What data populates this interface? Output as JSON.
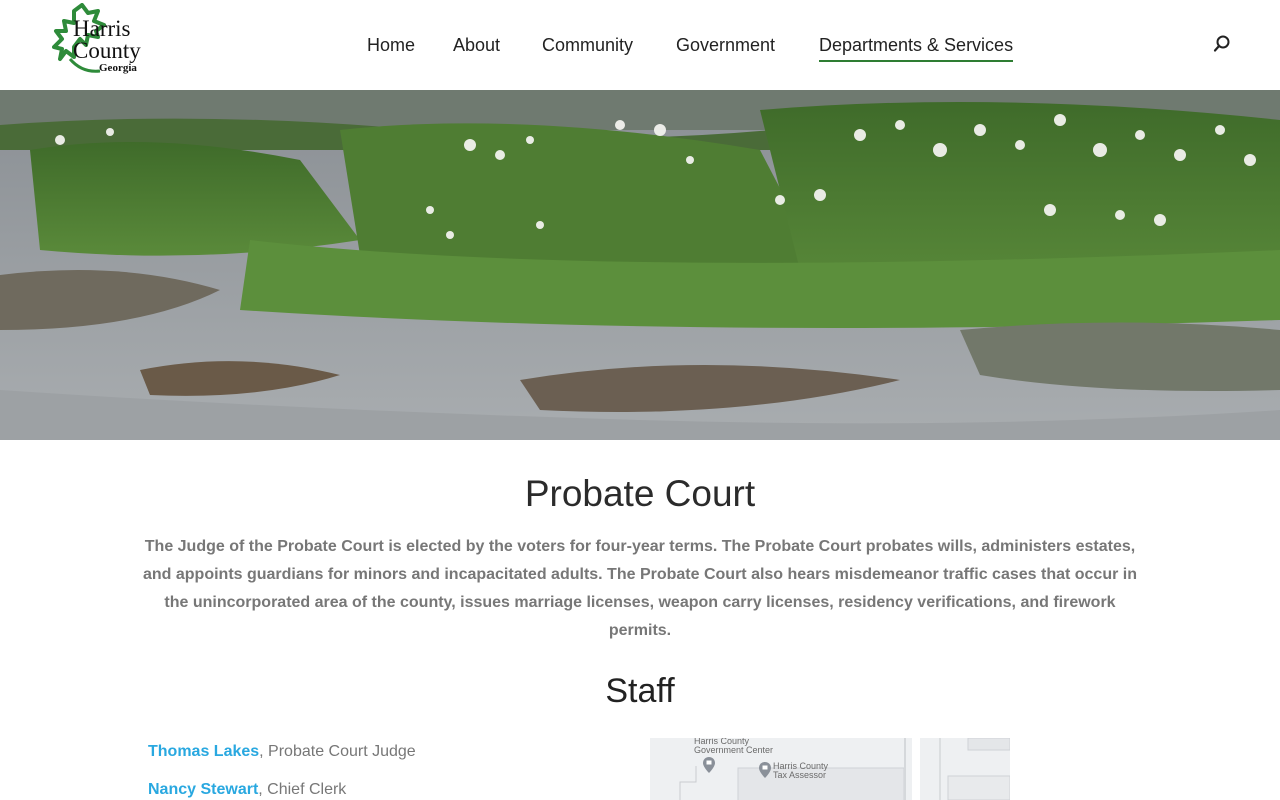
{
  "site": {
    "logo": {
      "line1": "Harris",
      "line2": "County",
      "line3": "Georgia"
    }
  },
  "nav": {
    "items": [
      {
        "label": "Home"
      },
      {
        "label": "About"
      },
      {
        "label": "Community"
      },
      {
        "label": "Government"
      },
      {
        "label": "Departments & Services",
        "active": true
      }
    ],
    "search_icon": "search-icon"
  },
  "hero": {
    "image": "river-shoals-lilies-photo"
  },
  "main": {
    "title": "Probate Court",
    "intro": "The Judge of the Probate Court is elected by the voters for four-year terms. The Probate Court probates wills, administers estates, and appoints guardians for minors and incapacitated adults. The Probate Court also hears misdemeanor traffic cases that occur in the unincorporated area of the county, issues marriage licenses, weapon carry licenses, residency verifications, and firework permits.",
    "staff_heading": "Staff",
    "staff": [
      {
        "name": "Thomas Lakes",
        "role": ", Probate Court Judge"
      },
      {
        "name": "Nancy Stewart",
        "role": ", Chief Clerk"
      }
    ]
  },
  "map": {
    "labels": [
      {
        "line1": "Harris County",
        "line2": "Government Center"
      },
      {
        "line1": "Harris County",
        "line2": "Tax Assessor"
      }
    ]
  },
  "colors": {
    "accent_green": "#2e7d32",
    "link_blue": "#29a8e0",
    "body_gray": "#777777"
  }
}
